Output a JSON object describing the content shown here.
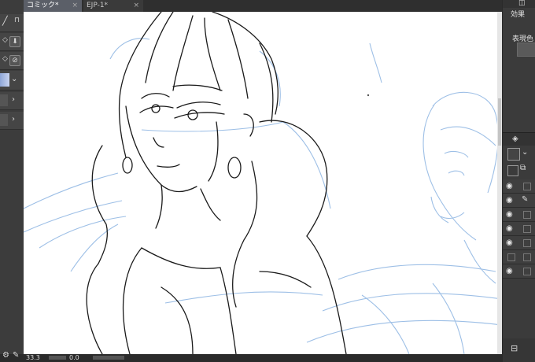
{
  "tabs": [
    {
      "label": "コミック*",
      "close": "×"
    },
    {
      "label": "EJP-1*",
      "close": "×"
    }
  ],
  "right_panel": {
    "section_title": "効果",
    "expression_color_label": "表現色"
  },
  "status": {
    "zoom": "33.3",
    "angle": "0.0"
  },
  "colors": {
    "canvas": "#ffffff",
    "line_art": "#1a1a1a",
    "sketch": "#9dbfe6",
    "panel": "#3b3b3b"
  },
  "icons": [
    "pen-icon",
    "lock-icon",
    "download-icon",
    "reset-icon",
    "chevron-right-icon",
    "eye-icon",
    "pencil-icon",
    "layers-icon",
    "copy-icon"
  ]
}
